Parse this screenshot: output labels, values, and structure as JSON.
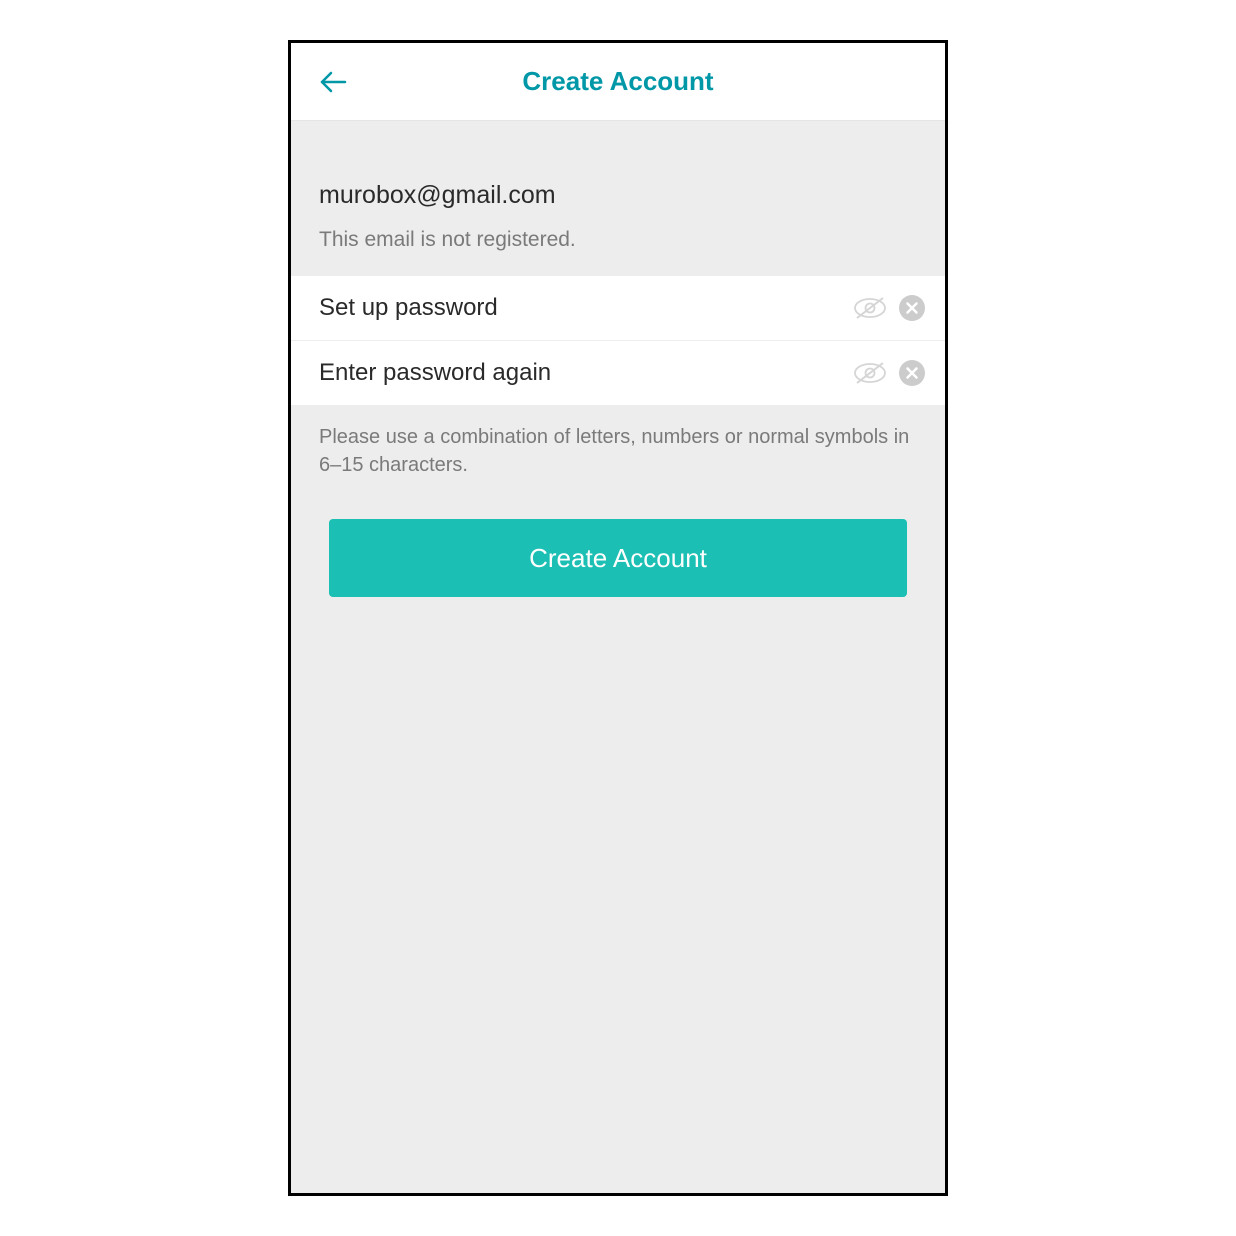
{
  "header": {
    "title": "Create Account"
  },
  "email": {
    "value": "murobox@gmail.com",
    "status": "This email is not registered."
  },
  "password": {
    "placeholder": "Set up password"
  },
  "password_confirm": {
    "placeholder": "Enter password again"
  },
  "hint": "Please use a combination of letters, numbers or normal symbols in 6–15 characters.",
  "submit": {
    "label": "Create Account"
  },
  "colors": {
    "accent": "#0097a7",
    "button": "#1cbfb3"
  }
}
